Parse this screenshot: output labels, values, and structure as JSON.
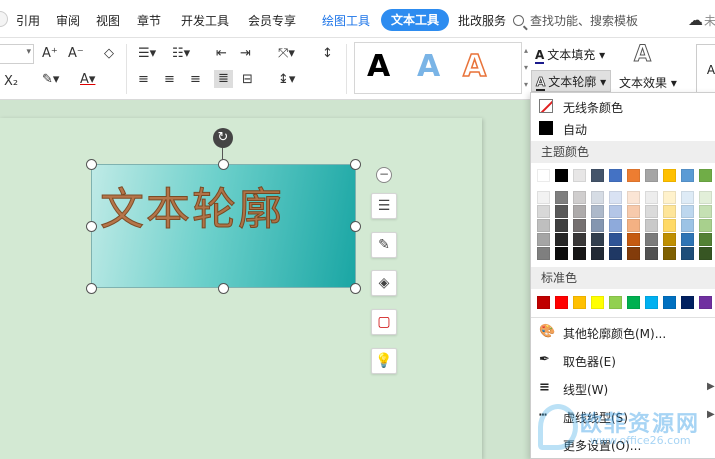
{
  "menubar": {
    "items": [
      "引用",
      "审阅",
      "视图",
      "章节",
      "开发工具",
      "会员专享"
    ],
    "tab_drawing": "绘图工具",
    "tab_text": "文本工具",
    "tab_review": "批改服务",
    "search_placeholder": "查找功能、搜索模板",
    "unsaved_stub": "未"
  },
  "ribbon": {
    "text_fill": "文本填充",
    "text_outline": "文本轮廓",
    "text_effect": "文本效果",
    "wordart_samples": [
      "A",
      "A",
      "A"
    ],
    "subscript": "X₂"
  },
  "canvas": {
    "textbox_text": "文本轮廓"
  },
  "dropdown": {
    "no_line": "无线条颜色",
    "auto": "自动",
    "theme_colors": "主题颜色",
    "standard_colors": "标准色",
    "more_colors": "其他轮廓颜色(M)...",
    "eyedropper": "取色器(E)",
    "line_type": "线型(W)",
    "dash_type": "虚线线型(S)",
    "more_settings": "更多设置(O)...",
    "theme_top_row": [
      "#ffffff",
      "#000000",
      "#e7e6e6",
      "#44546a",
      "#4472c4",
      "#ed7d31",
      "#a5a5a5",
      "#ffc000",
      "#5b9bd5",
      "#70ad47"
    ],
    "theme_shades": [
      [
        "#f2f2f2",
        "#7f7f7f",
        "#d0cece",
        "#d6dce4",
        "#d9e2f3",
        "#fbe5d5",
        "#ededed",
        "#fff2cc",
        "#deebf6",
        "#e2efd9"
      ],
      [
        "#d8d8d8",
        "#595959",
        "#aeabab",
        "#adb9ca",
        "#b4c6e7",
        "#f7caac",
        "#dbdbdb",
        "#fee599",
        "#bdd7ee",
        "#c5e0b3"
      ],
      [
        "#bfbfbf",
        "#3f3f3f",
        "#757070",
        "#8496b0",
        "#8eaadb",
        "#f4b183",
        "#c9c9c9",
        "#ffd965",
        "#9cc3e5",
        "#a8d08d"
      ],
      [
        "#a5a5a5",
        "#262626",
        "#3a3838",
        "#323f4f",
        "#2f5496",
        "#c55a11",
        "#7b7b7b",
        "#bf8f00",
        "#2e75b5",
        "#538135"
      ],
      [
        "#7f7f7f",
        "#0c0c0c",
        "#171616",
        "#222a35",
        "#1f3864",
        "#833c0b",
        "#525252",
        "#7f6000",
        "#1e4e79",
        "#375623"
      ]
    ],
    "standard_row": [
      "#c00000",
      "#ff0000",
      "#ffc000",
      "#ffff00",
      "#92d050",
      "#00b050",
      "#00b0f0",
      "#0070c0",
      "#002060",
      "#7030a0"
    ]
  },
  "watermark": {
    "text": "欧菲资源网",
    "url": "www.office26.com"
  }
}
